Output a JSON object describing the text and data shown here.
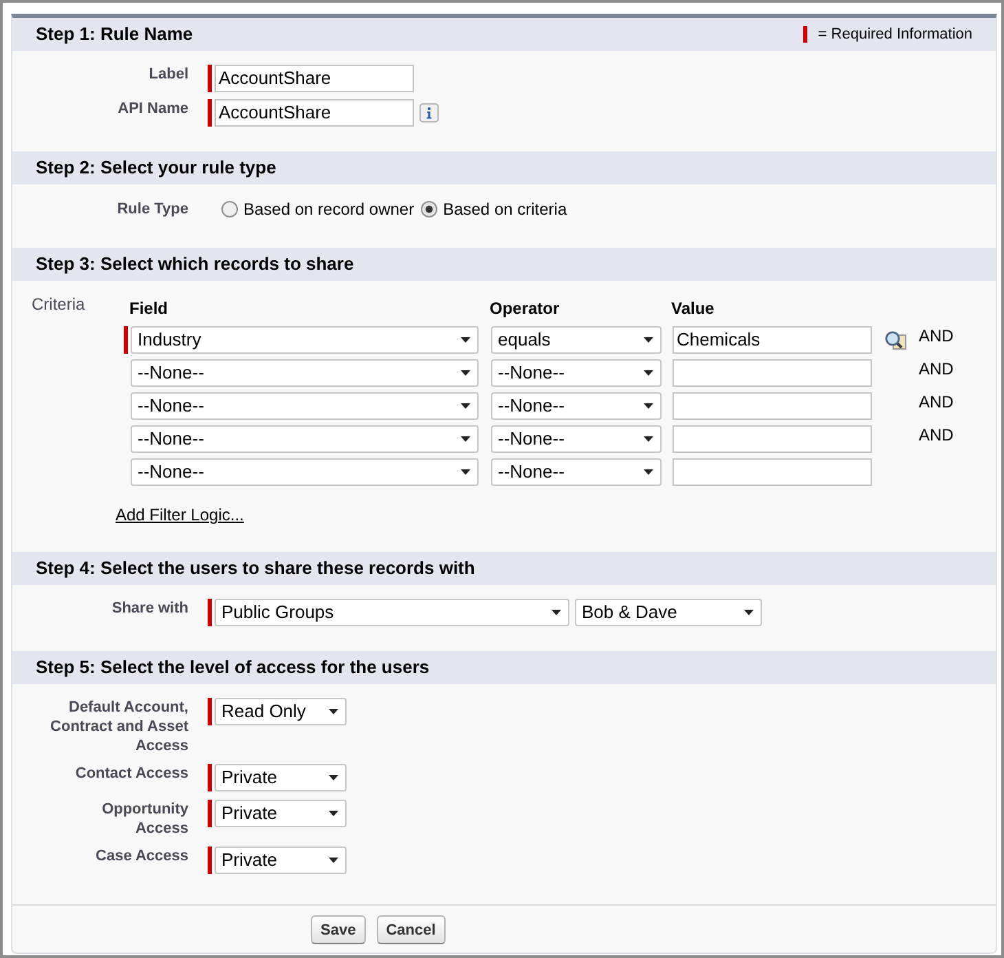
{
  "sections": [
    {
      "kind": "fields",
      "title": "Step 1: Rule Name",
      "legend": "= Required Information",
      "fields": [
        {
          "label": "Label",
          "value": "AccountShare",
          "required": true,
          "info": false
        },
        {
          "label": "API Name",
          "value": "AccountShare",
          "required": true,
          "info": true
        }
      ]
    },
    {
      "kind": "radio",
      "title": "Step 2: Select your rule type",
      "label": "Rule Type",
      "options": [
        {
          "label": "Based on record owner",
          "selected": false
        },
        {
          "label": "Based on criteria",
          "selected": true
        }
      ]
    },
    {
      "kind": "criteria",
      "title": "Step 3: Select which records to share",
      "label": "Criteria",
      "columns": [
        "Field",
        "Operator",
        "Value"
      ],
      "rows": [
        {
          "field": "Industry",
          "operator": "equals",
          "value": "Chemicals",
          "required": true,
          "lookup": true,
          "conjunction": "AND"
        },
        {
          "field": "--None--",
          "operator": "--None--",
          "required": false,
          "lookup": false,
          "conjunction": "AND"
        },
        {
          "field": "--None--",
          "operator": "--None--",
          "required": false,
          "lookup": false,
          "conjunction": "AND"
        },
        {
          "field": "--None--",
          "operator": "--None--",
          "required": false,
          "lookup": false,
          "conjunction": "AND"
        },
        {
          "field": "--None--",
          "operator": "--None--",
          "required": false,
          "lookup": false
        }
      ],
      "link": "Add Filter Logic..."
    },
    {
      "kind": "share",
      "title": "Step 4: Select the users to share these records with",
      "label": "Share with",
      "required": true,
      "selects": [
        "Public Groups",
        "Bob & Dave"
      ]
    },
    {
      "kind": "access",
      "title": "Step 5: Select the level of access for the users",
      "fields": [
        {
          "label": "Default Account, Contract and Asset Access",
          "value": "Read Only",
          "required": true
        },
        {
          "label": "Contact Access",
          "value": "Private",
          "required": true
        },
        {
          "label": "Opportunity Access",
          "value": "Private",
          "required": true
        },
        {
          "label": "Case Access",
          "value": "Private",
          "required": true
        }
      ]
    }
  ],
  "buttons": [
    "Save",
    "Cancel"
  ]
}
